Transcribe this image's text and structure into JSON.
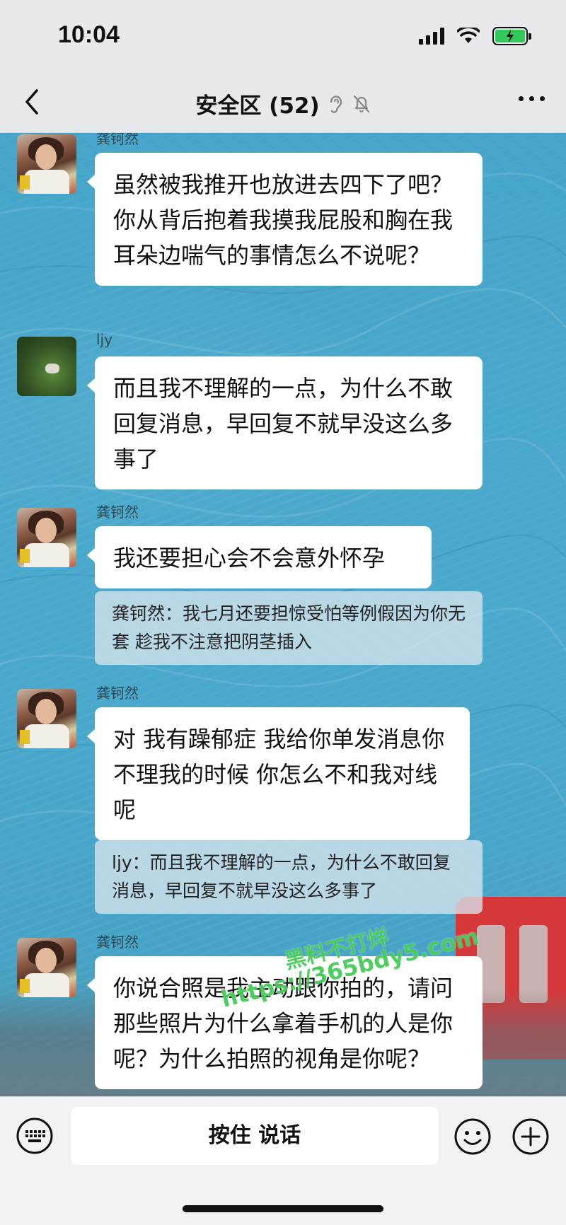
{
  "status_bar": {
    "time": "10:04"
  },
  "header": {
    "title": "安全区 (52)"
  },
  "messages": [
    {
      "sender": "龚钶然",
      "text": "虽然被我推开也放进去四下了吧？你从背后抱着我摸我屁股和胸在我耳朵边喘气的事情怎么不说呢？"
    },
    {
      "sender": "ljy",
      "text": "而且我不理解的一点，为什么不敢回复消息，早回复不就早没这么多事了"
    },
    {
      "sender": "龚钶然",
      "text": "我还要担心会不会意外怀孕",
      "quote": "龚钶然：我七月还要担惊受怕等例假因为你无套 趁我不注意把阴茎插入"
    },
    {
      "sender": "龚钶然",
      "text": "对 我有躁郁症 我给你单发消息你不理我的时候 你怎么不和我对线呢",
      "quote": "ljy：而且我不理解的一点，为什么不敢回复消息，早回复不就早没这么多事了"
    },
    {
      "sender": "龚钶然",
      "text": "你说合照是我主动跟你拍的，请问那些照片为什么拿着手机的人是你呢？为什么拍照的视角是你呢？"
    }
  ],
  "watermark": {
    "line1": "黑料不打烊",
    "line2": "https://365bdy5.com"
  },
  "input_bar": {
    "voice_label": "按住 说话"
  },
  "colors": {
    "chat_bg": "#46a5c8",
    "bubble": "#ffffff",
    "accent_green": "#34c759"
  }
}
